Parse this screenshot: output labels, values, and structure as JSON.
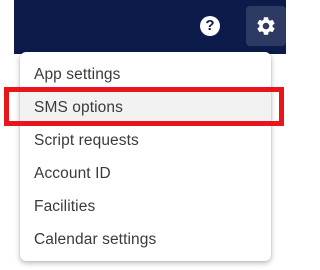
{
  "header": {
    "help_icon": "help-circle-icon",
    "help_glyph": "?",
    "settings_icon": "gear-icon",
    "background_color": "#0d1b4a"
  },
  "menu": {
    "items": [
      {
        "label": "App settings"
      },
      {
        "label": "SMS options"
      },
      {
        "label": "Script requests"
      },
      {
        "label": "Account ID"
      },
      {
        "label": "Facilities"
      },
      {
        "label": "Calendar settings"
      }
    ],
    "hovered_item": "SMS options"
  },
  "annotation": {
    "highlight_color": "#e8151b",
    "target": "SMS options"
  }
}
